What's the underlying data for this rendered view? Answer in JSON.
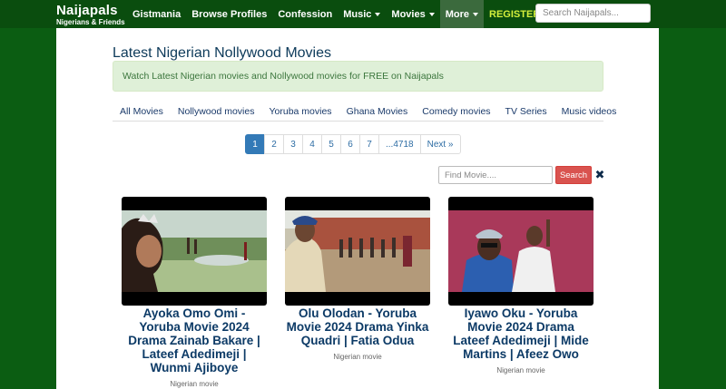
{
  "brand": {
    "name": "Naijapals",
    "tagline": "Nigerians & Friends"
  },
  "nav": {
    "items": [
      {
        "label": "Gistmania"
      },
      {
        "label": "Browse Profiles"
      },
      {
        "label": "Confession"
      },
      {
        "label": "Music"
      },
      {
        "label": "Movies"
      },
      {
        "label": "More"
      },
      {
        "label": "REGISTER"
      }
    ],
    "search_placeholder": "Search Naijapals..."
  },
  "page": {
    "title": "Latest Nigerian Nollywood Movies",
    "alert": "Watch Latest Nigerian movies and Nollywood movies for FREE on Naijapals"
  },
  "tabs": [
    {
      "label": "All Movies"
    },
    {
      "label": "Nollywood movies"
    },
    {
      "label": "Yoruba movies"
    },
    {
      "label": "Ghana Movies"
    },
    {
      "label": "Comedy movies"
    },
    {
      "label": "TV Series"
    },
    {
      "label": "Music videos"
    }
  ],
  "pagination": {
    "pages": [
      "1",
      "2",
      "3",
      "4",
      "5",
      "6",
      "7",
      "...4718",
      "Next »"
    ],
    "current": "1"
  },
  "movie_search": {
    "placeholder": "Find Movie....",
    "button_label": "Search",
    "clear_icon": "✖"
  },
  "movies": [
    {
      "title": "Ayoka Omo Omi - Yoruba Movie 2024 Drama Zainab Bakare | Lateef Adedimeji | Wunmi Ajiboye",
      "category": "Nigerian movie"
    },
    {
      "title": "Olu Olodan - Yoruba Movie 2024 Drama Yinka Quadri | Fatia Odua",
      "category": "Nigerian movie"
    },
    {
      "title": "Iyawo Oku - Yoruba Movie 2024 Drama Lateef Adedimeji | Mide Martins | Afeez Owo",
      "category": "Nigerian movie"
    }
  ],
  "colors": {
    "nav_bg": "#0a4d0e",
    "page_bg": "#0b5d12",
    "register": "#d4ef3c",
    "pagination_active": "#337ab7",
    "search_button": "#d9534f",
    "title_text": "#0c3a66"
  }
}
